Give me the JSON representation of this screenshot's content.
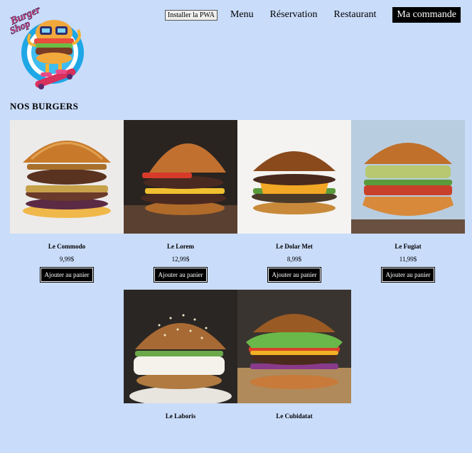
{
  "logo": {
    "line1": "Burger",
    "line2": "Shop"
  },
  "nav": {
    "pwa_label": "Installer la PWA",
    "links": [
      "Menu",
      "Réservation",
      "Restaurant"
    ],
    "cta_label": "Ma commande"
  },
  "section_title": "NOS BURGERS",
  "add_label": "Ajouter au panier",
  "products": [
    {
      "name": "Le Commodo",
      "price": "9,99$"
    },
    {
      "name": "Le Lorem",
      "price": "12,99$"
    },
    {
      "name": "Le Dolar Met",
      "price": "8,99$"
    },
    {
      "name": "Le Fugiat",
      "price": "11,99$"
    },
    {
      "name": "Le Laboris",
      "price": ""
    },
    {
      "name": "Le Cubidatat",
      "price": ""
    }
  ],
  "colors": {
    "page_bg": "#c9dcfa",
    "button_bg": "#000000",
    "button_text": "#ffffff"
  }
}
